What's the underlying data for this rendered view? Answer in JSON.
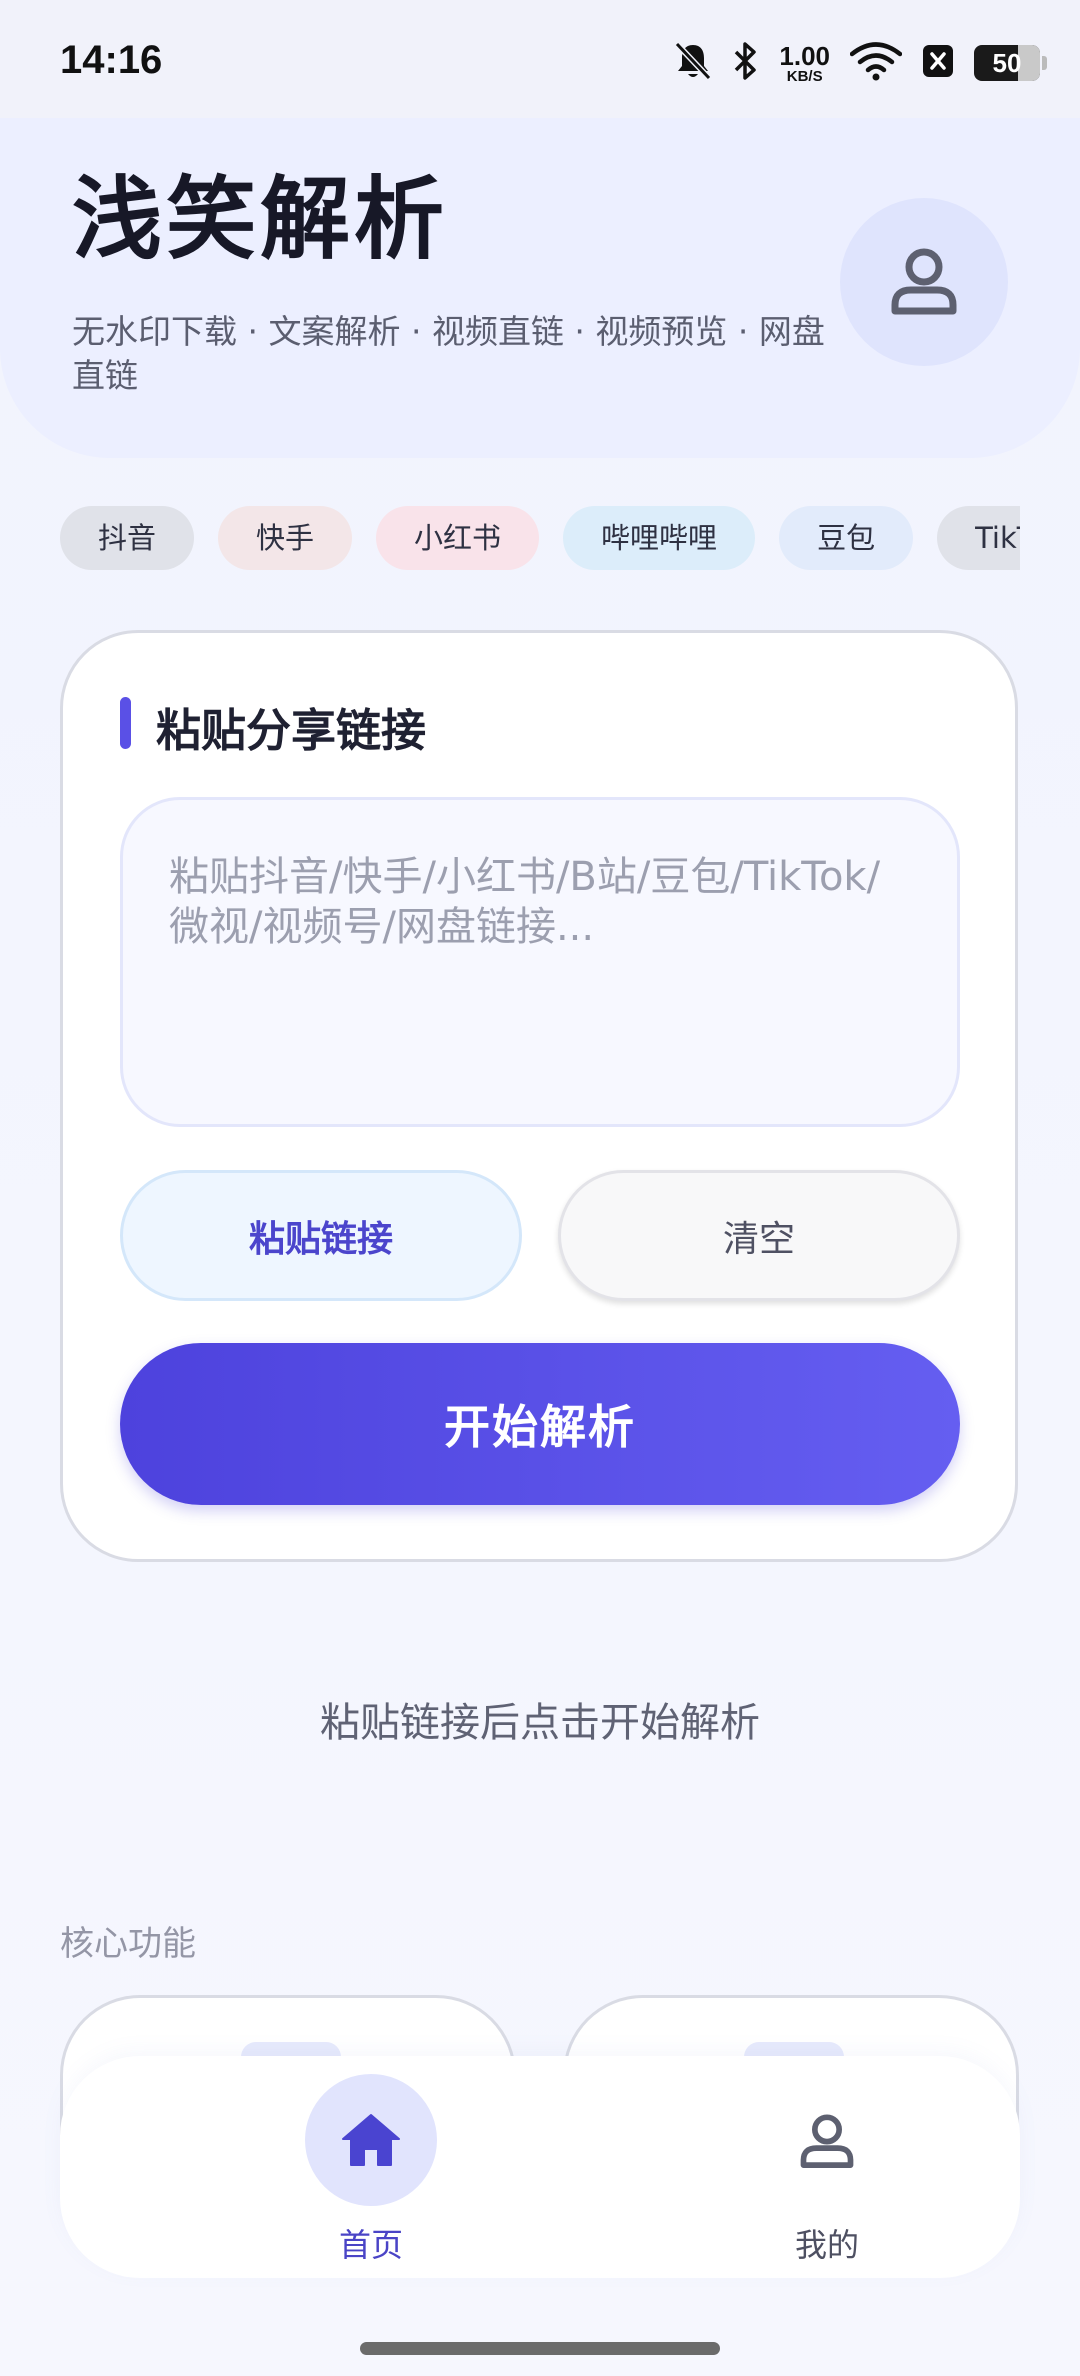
{
  "status_bar": {
    "time": "14:16",
    "net_speed_value": "1.00",
    "net_speed_unit": "KB/S",
    "battery": "50",
    "icons": [
      "bell-muted-icon",
      "bluetooth-icon",
      "wifi-icon",
      "x-app-icon",
      "battery-icon"
    ]
  },
  "header": {
    "title": "浅笑解析",
    "subtitle": "无水印下载 · 文案解析 · 视频直链 · 视频预览 · 网盘直链",
    "avatar_icon": "user-icon"
  },
  "platforms": [
    {
      "label": "抖音",
      "color": "#e0e2e9"
    },
    {
      "label": "快手",
      "color": "#f3e6e8"
    },
    {
      "label": "小红书",
      "color": "#f9e3ea"
    },
    {
      "label": "哔哩哔哩",
      "color": "#dcedfa"
    },
    {
      "label": "豆包",
      "color": "#e2ebfb"
    },
    {
      "label": "TikTok",
      "color": "#e0e2e9"
    }
  ],
  "card": {
    "title": "粘贴分享链接",
    "input_value": "",
    "input_placeholder": "粘贴抖音/快手/小红书/B站/豆包/TikTok/微视/视频号/网盘链接...",
    "paste_label": "粘贴链接",
    "clear_label": "清空",
    "start_label": "开始解析"
  },
  "hint": "粘贴链接后点击开始解析",
  "section_label": "核心功能",
  "nav": {
    "home_label": "首页",
    "mine_label": "我的",
    "home_icon": "home-icon",
    "mine_icon": "user-icon"
  },
  "colors": {
    "accent": "#5a50e6",
    "gradient_start": "#4d42dd",
    "gradient_end": "#655ef1"
  }
}
